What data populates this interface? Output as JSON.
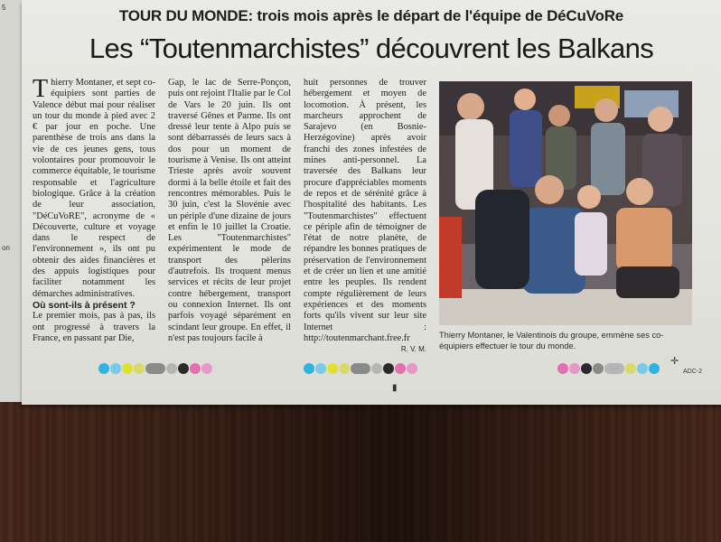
{
  "side_page": {
    "marks": [
      "5",
      "on"
    ]
  },
  "article": {
    "kicker": "TOUR DU MONDE: trois mois après le départ de l'équipe de DéCuVoRe",
    "headline": "Les “Toutenmarchistes” découvrent les Balkans",
    "dropcap": "T",
    "col1_p1": "hierry Montaner, et sept co-équipiers sont parties de Valence début mai pour réaliser un tour du monde à pied avec 2 € par jour en poche. Une parenthèse de trois ans dans la vie de ces jeunes gens, tous volontaires pour promouvoir le commerce équitable, le tourisme responsable et l'agriculture biologique. Grâce à la création de leur association, \"DéCuVoRE\", acronyme de « Découverte, culture et voyage dans le respect de l'environnement », ils ont pu obtenir des aides financières et des appuis logistiques pour faciliter notamment les démarches administratives.",
    "col1_subhead": "Où sont-ils à présent ?",
    "col1_p2": "Le premier mois, pas à pas, ils ont progressé à travers la France, en passant par Die,",
    "col2": "Gap, le lac de Serre-Ponçon, puis ont rejoint l'Italie par le Col de Vars le 20 juin. Ils ont traversé Gênes et Parme. Ils ont dressé leur tente à Alpo puis se sont débarrassés de leurs sacs à dos pour un moment de tourisme à Venise. Ils ont atteint Trieste après avoir souvent dormi à la belle étoile et fait des rencontres mémorables. Puis le 30 juin, c'est la Slovénie avec un périple d'une dizaine de jours et enfin le 10 juillet la Croatie. Les \"Toutenmarchistes\" expérimentent le mode de transport des pèlerins d'autrefois. Ils troquent menus services et récits de leur projet contre hébergement, transport ou connexion Internet. Ils ont parfois voyagé séparément en scindant leur groupe. En effet, il n'est pas toujours facile à",
    "col3": "huit personnes de trouver hébergement et moyen de locomotion. À présent, les marcheurs approchent de Sarajevo (en Bosnie-Herzégovine) après avoir franchi des zones infestées de mines anti-personnel. La traversée des Balkans leur procure d'appréciables moments de repos et de sérénité grâce à l'hospitalité des habitants. Les \"Toutenmarchistes\" effectuent ce périple afin de témoigner de l'état de notre planète, de répandre les bonnes pratiques de préservation de l'environnement et de créer un lien et une amitié entre les peuples. Ils rendent compte régulièrement de leurs expériences et des moments forts qu'ils vivent sur leur site Internet : http://toutenmarchant.free.fr",
    "signature": "R. V. M.",
    "caption": "Thierry Montaner, le Valentinois du groupe, emmène ses co-équipiers effectuer le tour du monde."
  },
  "print_marks": {
    "left_bar": [
      "#2fb3e0",
      "#79c9e8",
      "#e0e030",
      "#d9d96a",
      "#8a8a8a",
      "#b5b5b5",
      "#2a2a2a",
      "#e070b0",
      "#e898c8"
    ],
    "mid_bar": [
      "#2fb3e0",
      "#79c9e8",
      "#e0e030",
      "#d9d96a",
      "#8a8a8a",
      "#b5b5b5",
      "#2a2a2a",
      "#e070b0",
      "#e898c8"
    ],
    "right_bar": [
      "#e070b0",
      "#e898c8",
      "#2a2a2a",
      "#8a8a8a",
      "#b5b5b5",
      "#d9d96a",
      "#79c9e8",
      "#2fb3e0"
    ],
    "corner_code": "ADC-2"
  }
}
